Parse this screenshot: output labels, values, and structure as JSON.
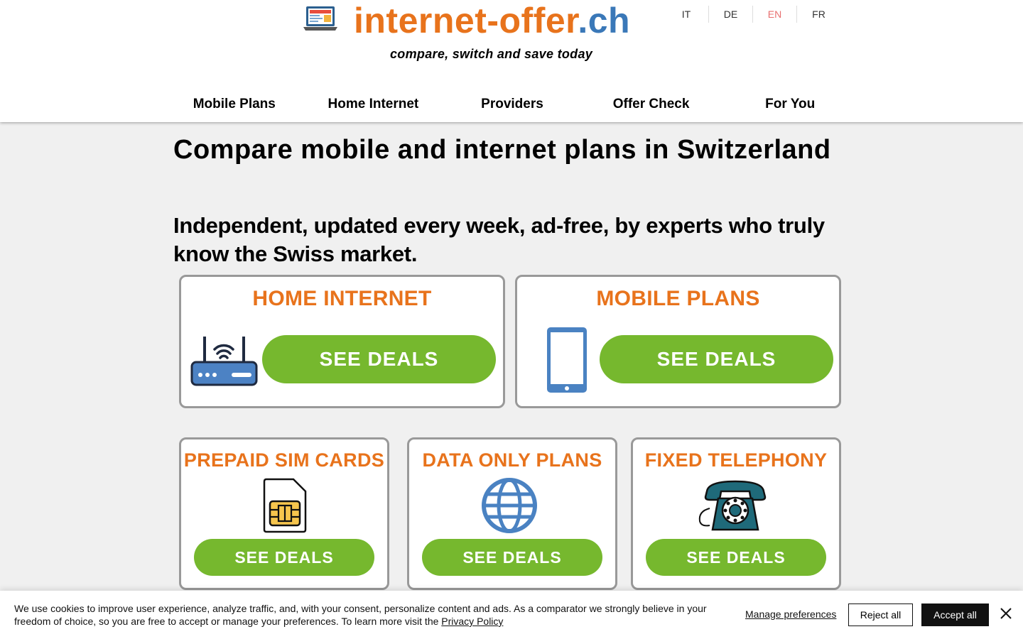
{
  "header": {
    "logo_main": "internet-offer",
    "logo_tld": ".ch",
    "tagline": "compare, switch and save today",
    "languages": [
      {
        "label": "IT"
      },
      {
        "label": "DE"
      },
      {
        "label": "EN"
      },
      {
        "label": "FR"
      }
    ],
    "active_language": "EN"
  },
  "nav": {
    "items": [
      {
        "label": "Mobile Plans"
      },
      {
        "label": "Home Internet"
      },
      {
        "label": "Providers"
      },
      {
        "label": "Offer Check"
      },
      {
        "label": "For You"
      }
    ]
  },
  "main": {
    "title": "Compare mobile and internet plans in Switzerland",
    "subtitle": "Independent, updated every week, ad-free, by experts who truly know the Swiss market.",
    "cards": [
      {
        "title": "HOME INTERNET",
        "button": "SEE DEALS",
        "icon": "router-icon"
      },
      {
        "title": "MOBILE PLANS",
        "button": "SEE DEALS",
        "icon": "smartphone-icon"
      },
      {
        "title": "PREPAID SIM CARDS",
        "button": "SEE DEALS",
        "icon": "sim-card-icon"
      },
      {
        "title": "DATA ONLY PLANS",
        "button": "SEE DEALS",
        "icon": "globe-icon"
      },
      {
        "title": "FIXED TELEPHONY",
        "button": "SEE DEALS",
        "icon": "telephone-icon"
      }
    ]
  },
  "colors": {
    "brand_orange": "#e8731c",
    "brand_blue": "#3a78b8",
    "deal_green": "#76b82e",
    "active_lang": "#e87070"
  },
  "cookie": {
    "text": "We use cookies to improve user experience, analyze traffic, and, with your consent, personalize content and ads. As a comparator we strongly believe in your freedom of choice, so you are free to accept or manage your preferences. To learn more visit the",
    "link": "Privacy Policy",
    "manage": "Manage preferences",
    "reject": "Reject all",
    "accept": "Accept all"
  }
}
